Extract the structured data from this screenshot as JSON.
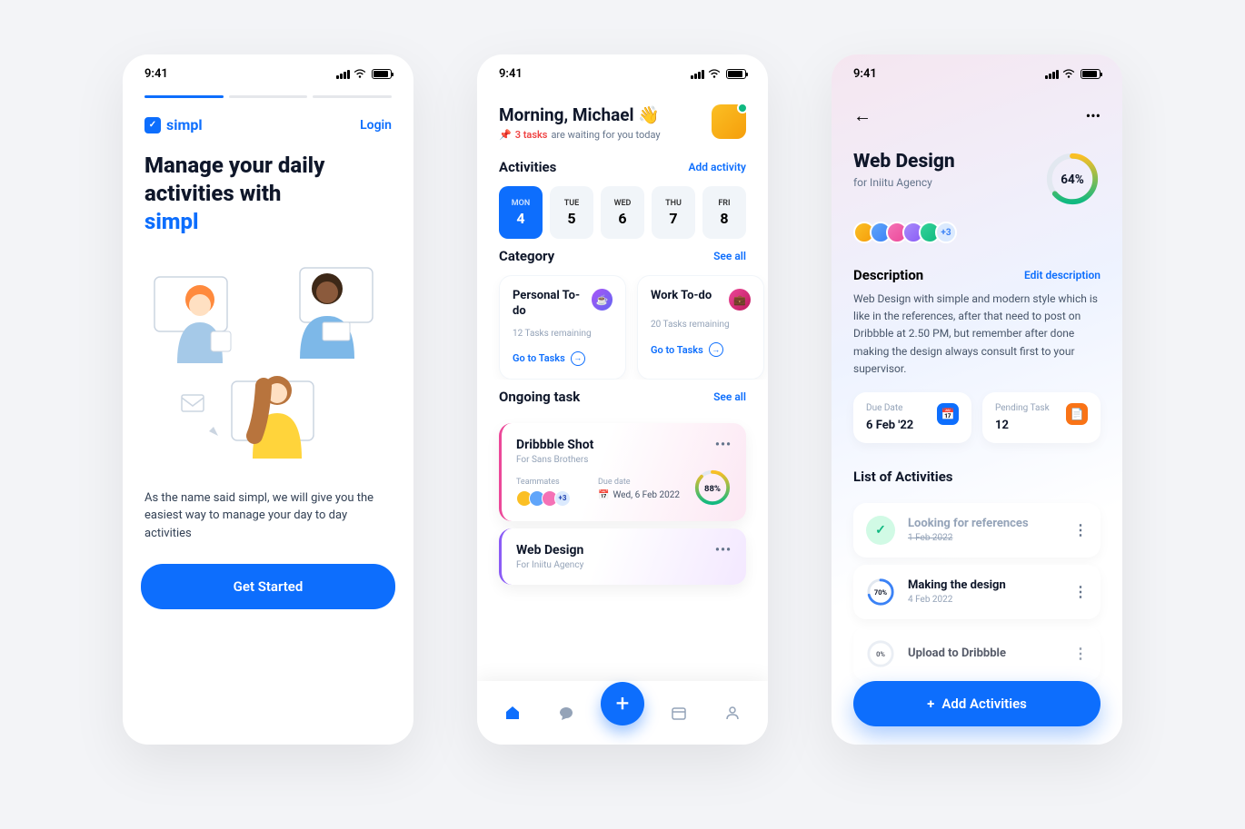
{
  "status_time": "9:41",
  "screen1": {
    "logo": "simpl",
    "login": "Login",
    "title_line1": "Manage your daily",
    "title_line2": "activities with",
    "title_brand": "simpl",
    "subtitle": "As the name said simpl, we will give you the easiest way to manage your day to day activities",
    "cta": "Get Started"
  },
  "screen2": {
    "greeting": "Morning, Michael 👋",
    "tasks_count": "3 tasks",
    "tasks_suffix": "are waiting for you today",
    "activities": "Activities",
    "add_activity": "Add activity",
    "days": [
      {
        "dow": "MON",
        "num": "4"
      },
      {
        "dow": "TUE",
        "num": "5"
      },
      {
        "dow": "WED",
        "num": "6"
      },
      {
        "dow": "THU",
        "num": "7"
      },
      {
        "dow": "FRI",
        "num": "8"
      }
    ],
    "category": "Category",
    "see_all": "See all",
    "cats": [
      {
        "name": "Personal To-do",
        "remaining": "12 Tasks remaining",
        "cta": "Go to Tasks"
      },
      {
        "name": "Work To-do",
        "remaining": "20 Tasks remaining",
        "cta": "Go to Tasks"
      }
    ],
    "ongoing": "Ongoing task",
    "tasks": [
      {
        "title": "Dribbble Shot",
        "for": "For Sans Brothers",
        "teammates": "Teammates",
        "due_label": "Due date",
        "due": "Wed, 6 Feb 2022",
        "more": "+3",
        "pct": "88%"
      },
      {
        "title": "Web Design",
        "for": "For Iniitu Agency"
      }
    ]
  },
  "screen3": {
    "title": "Web Design",
    "for": "for Iniitu Agency",
    "pct": "64%",
    "members_more": "+3",
    "desc_head": "Description",
    "edit": "Edit description",
    "desc": "Web Design with simple and modern style which is like in the references, after that need to post on Dribbble at 2.50 PM, but remember after done making the design always consult first to your supervisor.",
    "due_label": "Due Date",
    "due": "6 Feb '22",
    "pending_label": "Pending Task",
    "pending": "12",
    "list_title": "List of Activities",
    "activities": [
      {
        "title": "Looking for references",
        "date": "1 Feb 2022",
        "done": true
      },
      {
        "title": "Making the design",
        "date": "4 Feb 2022",
        "pct": "70%"
      },
      {
        "title": "Upload to Dribbble",
        "pct": "0%"
      }
    ],
    "add": "Add Activities"
  }
}
